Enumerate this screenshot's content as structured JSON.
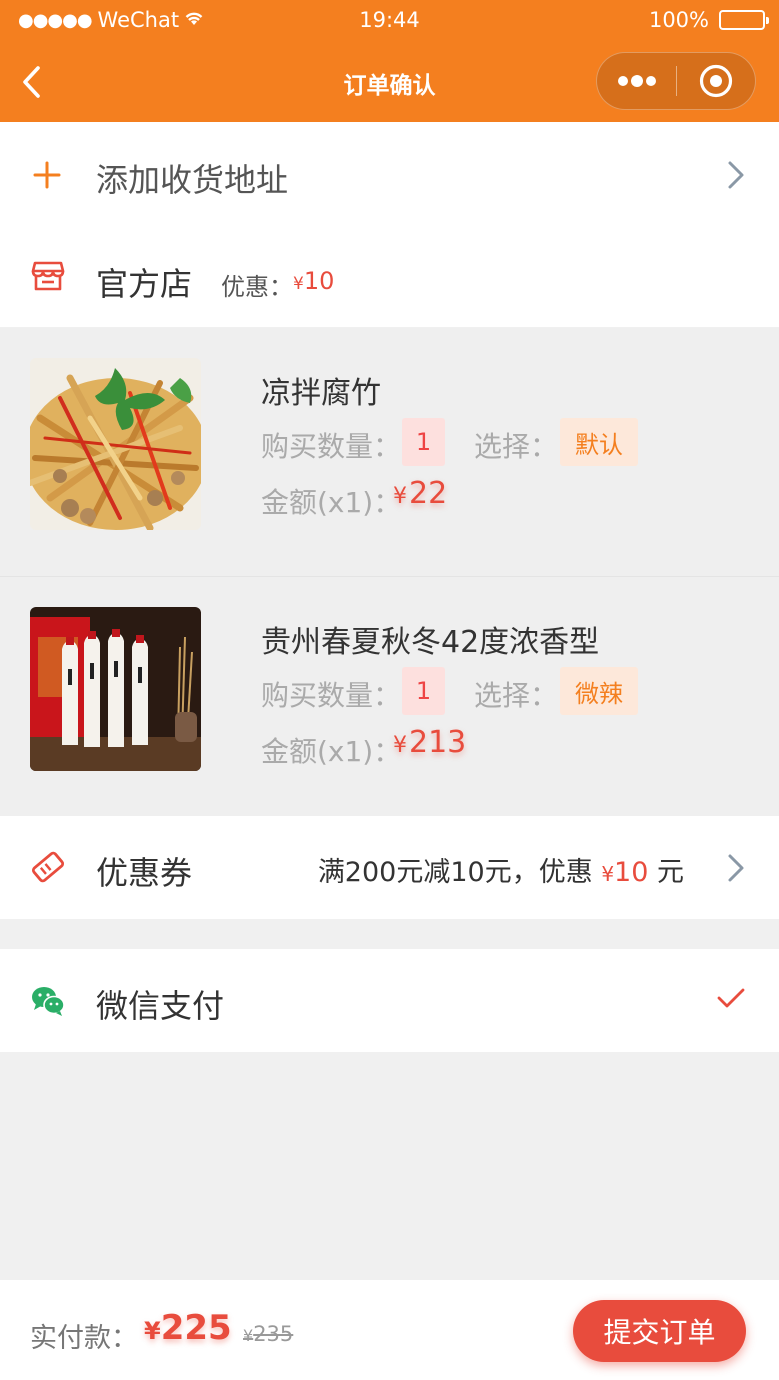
{
  "status_bar": {
    "signal": "●●●●●",
    "carrier": "WeChat",
    "time": "19:44",
    "battery": "100%"
  },
  "nav": {
    "title": "订单确认"
  },
  "address": {
    "add_label": "添加收货地址"
  },
  "shop": {
    "name": "官方店",
    "discount_label": "优惠：",
    "discount_currency": "¥",
    "discount_value": "10"
  },
  "items": [
    {
      "name": "凉拌腐竹",
      "qty_label": "购买数量：",
      "qty": "1",
      "option_label": "选择：",
      "option": "默认",
      "amount_label": "金额(x1)：",
      "currency": "¥",
      "price": "22"
    },
    {
      "name": "贵州春夏秋冬42度浓香型",
      "qty_label": "购买数量：",
      "qty": "1",
      "option_label": "选择：",
      "option": "微辣",
      "amount_label": "金额(x1)：",
      "currency": "¥",
      "price": "213"
    }
  ],
  "coupon": {
    "label": "优惠券",
    "desc_prefix": "满200元减10元，优惠",
    "currency": "¥",
    "value": "10",
    "unit": "元"
  },
  "payment": {
    "method": "微信支付"
  },
  "footer": {
    "paid_label": "实付款：",
    "currency": "¥",
    "total": "225",
    "orig_currency": "¥",
    "original": "235",
    "submit_label": "提交订单"
  },
  "colors": {
    "brand_orange": "#f47f1f",
    "price_red": "#e84c3d",
    "wechat_green": "#2aae67"
  }
}
